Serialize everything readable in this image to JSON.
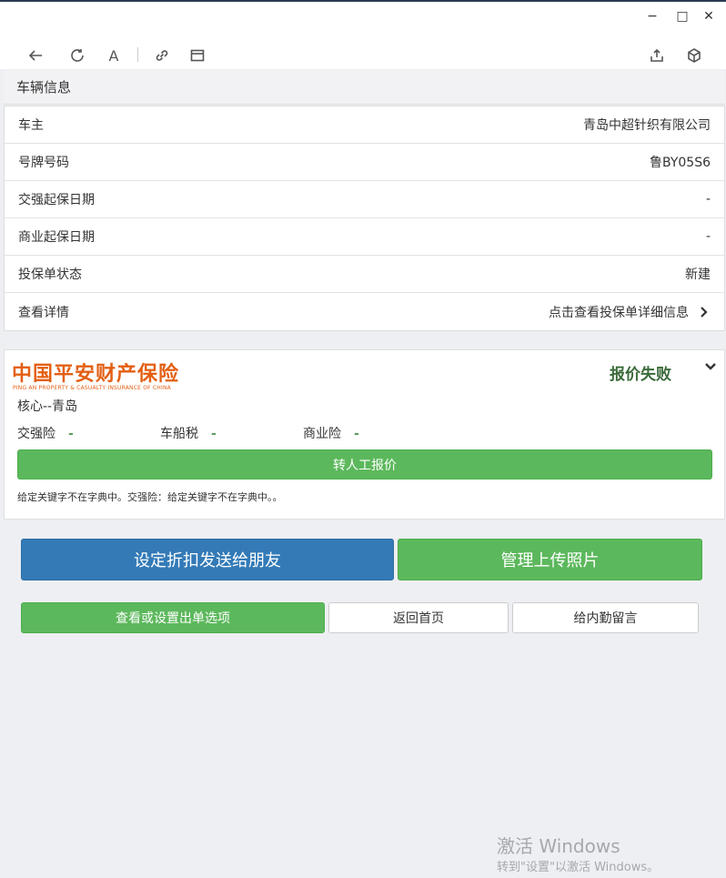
{
  "window": {
    "controls": {
      "minimize": "−",
      "maximize": "□",
      "close": "✕"
    },
    "toolbar": {
      "icons": [
        "back-icon",
        "refresh-icon",
        "font-icon",
        "link-icon",
        "window-icon",
        "share-icon",
        "cube-icon"
      ],
      "font_label": "A"
    }
  },
  "vehicle_section": {
    "title": "车辆信息"
  },
  "vehicle_rows": [
    {
      "label": "车主",
      "value": "青岛中超针织有限公司"
    },
    {
      "label": "号牌号码",
      "value": "鲁BY05S6"
    },
    {
      "label": "交强起保日期",
      "value": "-"
    },
    {
      "label": "商业起保日期",
      "value": "-"
    },
    {
      "label": "投保单状态",
      "value": "新建"
    },
    {
      "label": "查看详情",
      "value": "点击查看投保单详细信息"
    }
  ],
  "quote": {
    "logo_cn": "中国平安财产保险",
    "logo_en": "PING AN PROPERTY & CASUALTY INSURANCE OF CHINA",
    "status": "报价失败",
    "core": "核心--青岛",
    "fees": [
      {
        "label": "交强险",
        "value": "-"
      },
      {
        "label": "车船税",
        "value": "-"
      },
      {
        "label": "商业险",
        "value": "-"
      }
    ],
    "manual_button": "转人工报价",
    "message": "给定关键字不在字典中。交强险：给定关键字不在字典中。。",
    "colors": {
      "brand": "#e35f13",
      "status": "#3a6a3a",
      "success": "#5cb85c"
    }
  },
  "actions": {
    "discount_send": "设定折扣发送给朋友",
    "manage_photos": "管理上传照片",
    "view_options": "查看或设置出单选项",
    "back_home": "返回首页",
    "leave_message": "给内勤留言"
  },
  "watermark": {
    "line1": "激活 Windows",
    "line2": "转到\"设置\"以激活 Windows。"
  }
}
